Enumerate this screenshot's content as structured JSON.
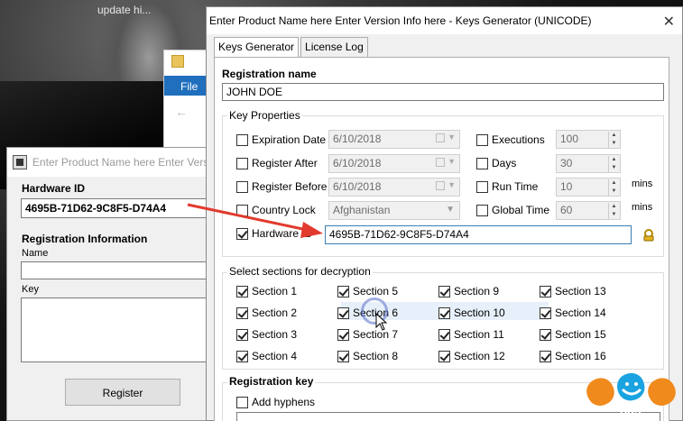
{
  "desktop": {
    "corner_text": "update hi..."
  },
  "explorer": {
    "file_tab": "File",
    "back_glyph": "←"
  },
  "reg_window": {
    "title": "Enter Product Name here Enter Versi",
    "hardware_id_label": "Hardware ID",
    "hardware_id_value": "4695B-71D62-9C8F5-D74A4",
    "registration_info_label": "Registration Information",
    "name_label": "Name",
    "name_value": "",
    "key_label": "Key",
    "key_value": "",
    "register_button": "Register"
  },
  "keygen": {
    "title": "Enter Product Name here Enter Version Info here - Keys Generator (UNICODE)",
    "close_glyph": "✕",
    "tabs": [
      {
        "label": "Keys Generator",
        "active": true
      },
      {
        "label": "License Log",
        "active": false
      }
    ],
    "registration_name_label": "Registration name",
    "registration_name_value": "JOHN DOE",
    "key_properties": {
      "title": "Key Properties",
      "expiration_date": {
        "label": "Expiration Date",
        "checked": false,
        "value": "6/10/2018"
      },
      "register_after": {
        "label": "Register After",
        "checked": false,
        "value": "6/10/2018"
      },
      "register_before": {
        "label": "Register Before",
        "checked": false,
        "value": "6/10/2018"
      },
      "country_lock": {
        "label": "Country Lock",
        "checked": false,
        "value": "Afghanistan"
      },
      "hardware_id": {
        "label": "Hardware ID",
        "checked": true,
        "value": "4695B-71D62-9C8F5-D74A4"
      },
      "executions": {
        "label": "Executions",
        "checked": false,
        "value": "100"
      },
      "days": {
        "label": "Days",
        "checked": false,
        "value": "30"
      },
      "run_time": {
        "label": "Run Time",
        "checked": false,
        "value": "10",
        "unit": "mins"
      },
      "global_time": {
        "label": "Global Time",
        "checked": false,
        "value": "60",
        "unit": "mins"
      }
    },
    "sections": {
      "title": "Select sections for decryption",
      "items": [
        {
          "label": "Section 1",
          "checked": true
        },
        {
          "label": "Section 2",
          "checked": true
        },
        {
          "label": "Section 3",
          "checked": true
        },
        {
          "label": "Section 4",
          "checked": true
        },
        {
          "label": "Section 5",
          "checked": true
        },
        {
          "label": "Section 6",
          "checked": true
        },
        {
          "label": "Section 7",
          "checked": true
        },
        {
          "label": "Section 8",
          "checked": true
        },
        {
          "label": "Section 9",
          "checked": true
        },
        {
          "label": "Section 10",
          "checked": true
        },
        {
          "label": "Section 11",
          "checked": true
        },
        {
          "label": "Section 12",
          "checked": true
        },
        {
          "label": "Section 13",
          "checked": true
        },
        {
          "label": "Section 14",
          "checked": true
        },
        {
          "label": "Section 15",
          "checked": true
        },
        {
          "label": "Section 16",
          "checked": true
        }
      ]
    },
    "registration_key": {
      "title": "Registration key",
      "add_hyphens_label": "Add hyphens",
      "add_hyphens_checked": false,
      "value": ""
    }
  },
  "watermark": {
    "text": "305"
  },
  "colors": {
    "annotation_arrow": "#e23a2e",
    "explorer_tab": "#1f6fbd",
    "logo_orange": "#f08a1c",
    "logo_blue": "#1aa3e0"
  }
}
